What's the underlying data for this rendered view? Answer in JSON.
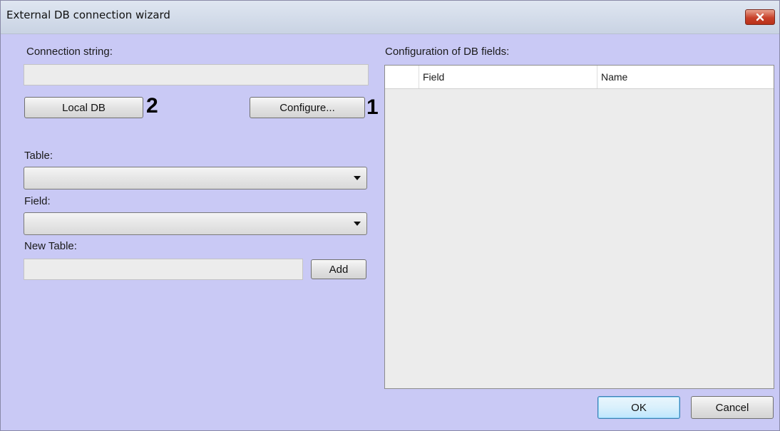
{
  "window": {
    "title": "External DB connection wizard",
    "close_icon": "close-icon"
  },
  "connection": {
    "label": "Connection string:",
    "value": ""
  },
  "buttons": {
    "local_db": "Local DB",
    "configure": "Configure...",
    "add": "Add",
    "ok": "OK",
    "cancel": "Cancel"
  },
  "markers": {
    "local_db": "2",
    "configure": "1"
  },
  "table": {
    "label": "Table:",
    "value": ""
  },
  "field": {
    "label": "Field:",
    "value": ""
  },
  "new_table": {
    "label": "New Table:",
    "value": ""
  },
  "config": {
    "label": "Configuration of DB fields:",
    "columns": [
      "",
      "Field",
      "Name"
    ],
    "rows": []
  },
  "colors": {
    "dialog_bg": "#c9c9f5",
    "close_red": "#c8412a",
    "ok_accent": "#3c7fb1"
  }
}
